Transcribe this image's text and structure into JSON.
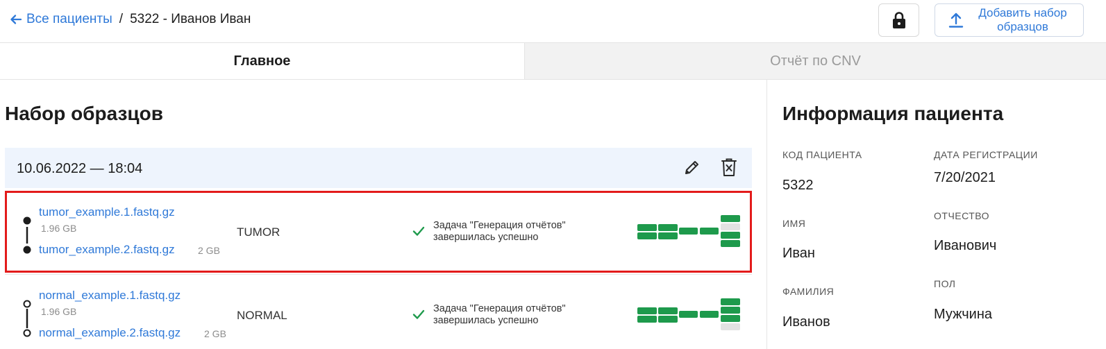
{
  "header": {
    "breadcrumb_link": "Все пациенты",
    "breadcrumb_sep": "/",
    "breadcrumb_current": "5322 - Иванов Иван",
    "add_button_label": "Добавить набор образцов"
  },
  "tabs": [
    {
      "label": "Главное",
      "active": true
    },
    {
      "label": "Отчёт по CNV",
      "active": false
    }
  ],
  "samples_section": {
    "title": "Набор образцов",
    "set_date": "10.06.2022 — 18:04",
    "rows": [
      {
        "file1": "tumor_example.1.fastq.gz",
        "file1_size": "1.96 GB",
        "file2": "tumor_example.2.fastq.gz",
        "file2_size": "2 GB",
        "type": "TUMOR",
        "status": "Задача \"Генерация отчётов\" завершилась успешно",
        "highlighted": true
      },
      {
        "file1": "normal_example.1.fastq.gz",
        "file1_size": "1.96 GB",
        "file2": "normal_example.2.fastq.gz",
        "file2_size": "2 GB",
        "type": "NORMAL",
        "status": "Задача \"Генерация отчётов\" завершилась успешно",
        "highlighted": false
      }
    ]
  },
  "patient_info": {
    "title": "Информация пациента",
    "fields": {
      "code_label": "КОД ПАЦИЕНТА",
      "code_value": "5322",
      "reg_label": "ДАТА РЕГИСТРАЦИИ",
      "reg_value": "7/20/2021",
      "first_name_label": "ИМЯ",
      "first_name_value": "Иван",
      "patronymic_label": "ОТЧЕСТВО",
      "patronymic_value": "Иванович",
      "last_name_label": "ФАМИЛИЯ",
      "last_name_value": "Иванов",
      "sex_label": "ПОЛ",
      "sex_value": "Мужчина"
    }
  },
  "colors": {
    "accent": "#2f79d8",
    "success": "#1e9a4c",
    "highlight": "#e31b1b",
    "set_header_bg": "#eef4fd"
  },
  "icons": [
    "arrow-left-icon",
    "lock-icon",
    "upload-icon",
    "pencil-icon",
    "trash-icon",
    "check-icon",
    "file-pair-icon",
    "pipeline-progress-icon"
  ]
}
